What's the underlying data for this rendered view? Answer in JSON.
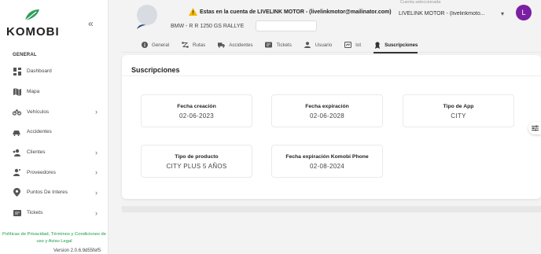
{
  "brand": {
    "name": "KOMOBI"
  },
  "sidebar": {
    "section": "GENERAL",
    "items": [
      {
        "label": "Dashboard",
        "icon": "dashboard-icon",
        "has_chevron": false
      },
      {
        "label": "Mapa",
        "icon": "map-icon",
        "has_chevron": false
      },
      {
        "label": "Vehículos",
        "icon": "vehicle-icon",
        "has_chevron": true
      },
      {
        "label": "Accidentes",
        "icon": "accident-icon",
        "has_chevron": false
      },
      {
        "label": "Clientes",
        "icon": "clients-icon",
        "has_chevron": true
      },
      {
        "label": "Proveedores",
        "icon": "providers-icon",
        "has_chevron": true
      },
      {
        "label": "Puntos De Interes",
        "icon": "pin-icon",
        "has_chevron": true
      },
      {
        "label": "Tickets",
        "icon": "tickets-icon",
        "has_chevron": true
      }
    ],
    "footer_link": "Políticas de Privacidad, Términos y Condiciones de uso y Aviso Legal",
    "version": "Version 2.0.6.9d55fef5"
  },
  "topbar": {
    "banner": "Estas en la cuenta de LIVELINK MOTOR - (livelinkmotor@mailinator.com)",
    "account_label": "Cuenta seleccionada",
    "account_value": "LIVELINK MOTOR - (livelinkmoto...",
    "user_initial": "L"
  },
  "vehicle": {
    "title": "BMW - R R 1250 GS RALLYE"
  },
  "tabs": [
    {
      "label": "General",
      "icon": "info-icon",
      "active": false
    },
    {
      "label": "Rutas",
      "icon": "routes-icon",
      "active": false
    },
    {
      "label": "Accidentes",
      "icon": "truck-icon",
      "active": false
    },
    {
      "label": "Tickets",
      "icon": "ticket-icon",
      "active": false
    },
    {
      "label": "Usuario",
      "icon": "user-icon",
      "active": false
    },
    {
      "label": "Iot",
      "icon": "iot-icon",
      "active": false
    },
    {
      "label": "Suscripciones",
      "icon": "subscription-icon",
      "active": true
    }
  ],
  "panel": {
    "title": "Suscripciones",
    "fields": [
      {
        "key": "Fecha creación",
        "value": "02-06-2023"
      },
      {
        "key": "Fecha expiración",
        "value": "02-06-2028"
      },
      {
        "key": "Tipo de App",
        "value": "CITY"
      },
      {
        "key": "Tipo de producto",
        "value": "CITY PLUS 5 AÑOS"
      },
      {
        "key": "Fecha expiración Komobi Phone",
        "value": "02-08-2024"
      }
    ]
  },
  "colors": {
    "accent_green": "#1e9a4a",
    "avatar_purple": "#7b1fa2",
    "warning": "#f5b800"
  }
}
